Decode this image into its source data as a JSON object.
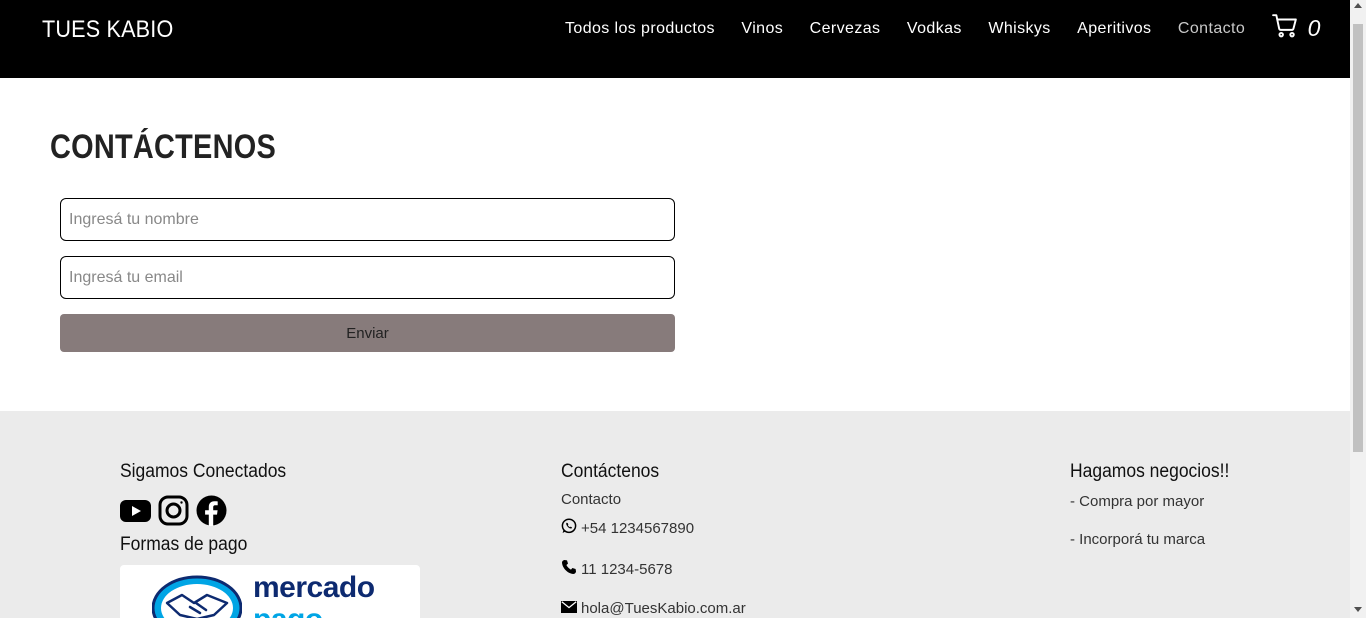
{
  "header": {
    "brand": "TUES KABIO",
    "nav": [
      {
        "label": "Todos los productos"
      },
      {
        "label": "Vinos"
      },
      {
        "label": "Cervezas"
      },
      {
        "label": "Vodkas"
      },
      {
        "label": "Whiskys"
      },
      {
        "label": "Aperitivos"
      },
      {
        "label": "Contacto"
      }
    ],
    "cart_icon": "shopping-cart-icon",
    "cart_count": "0"
  },
  "main": {
    "title": "CONTÁCTENOS",
    "name_placeholder": "Ingresá tu nombre",
    "email_placeholder": "Ingresá tu email",
    "submit_label": "Enviar"
  },
  "footer": {
    "social": {
      "heading": "Sigamos Conectados",
      "icons": [
        "youtube-icon",
        "instagram-icon",
        "facebook-icon"
      ],
      "payments_heading": "Formas de pago",
      "payment_brand": "mercado",
      "payment_brand_2": "pago"
    },
    "contact": {
      "heading": "Contáctenos",
      "subtitle": "Contacto",
      "whatsapp": "+54 1234567890",
      "phone": "11 1234-5678",
      "email": "hola@TuesKabio.com.ar"
    },
    "business": {
      "heading": "Hagamos negocios!!",
      "links": [
        "- Compra por mayor",
        "- Incorporá tu marca"
      ]
    }
  },
  "colors": {
    "navbar_bg": "#000000",
    "button_bg": "#877b7b",
    "footer_bg": "#ebebeb",
    "mp_dark": "#0d2a70",
    "mp_light": "#00a5e5"
  }
}
